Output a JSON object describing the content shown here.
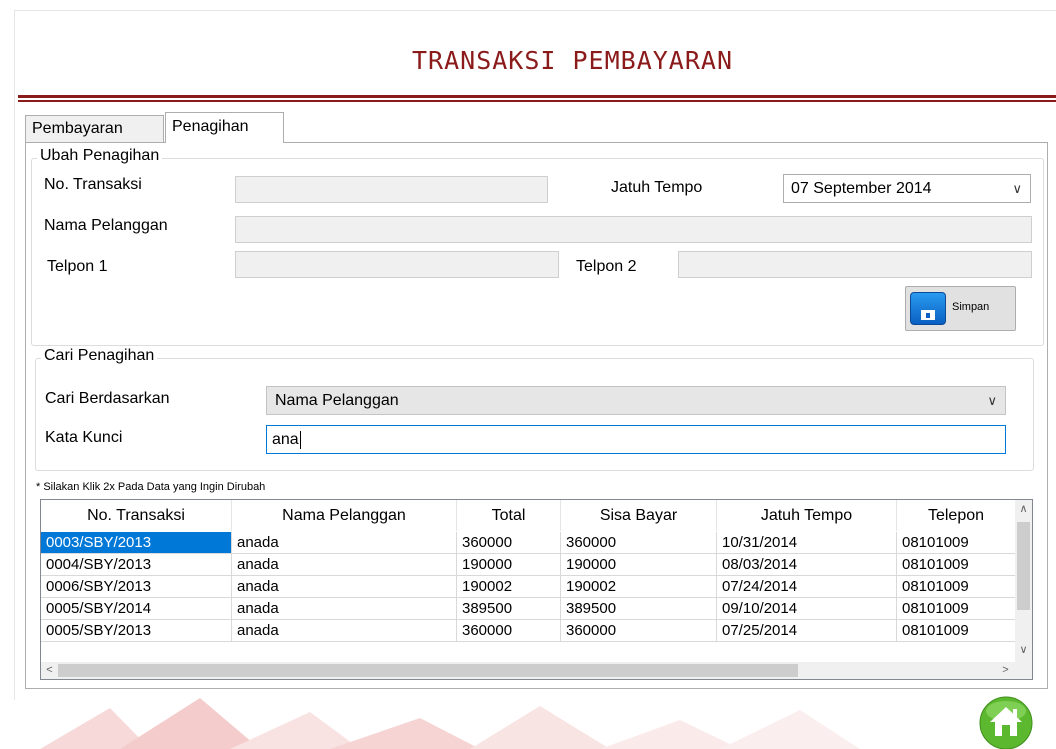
{
  "title": "TRANSAKSI PEMBAYARAN",
  "tabs": [
    {
      "label": "Pembayaran",
      "active": false
    },
    {
      "label": "Penagihan",
      "active": true
    }
  ],
  "ubah": {
    "legend": "Ubah Penagihan",
    "no_transaksi_label": "No. Transaksi",
    "no_transaksi_value": "",
    "jatuh_tempo_label": "Jatuh Tempo",
    "jatuh_tempo_value": "07 September 2014",
    "nama_pelanggan_label": "Nama Pelanggan",
    "nama_pelanggan_value": "",
    "telpon1_label": "Telpon 1",
    "telpon1_value": "",
    "telpon2_label": "Telpon 2",
    "telpon2_value": "",
    "simpan_label": "Simpan"
  },
  "cari": {
    "legend": "Cari Penagihan",
    "berdasarkan_label": "Cari Berdasarkan",
    "berdasarkan_value": "Nama Pelanggan",
    "kata_kunci_label": "Kata Kunci",
    "kata_kunci_value": "ana"
  },
  "note": "* Silakan Klik 2x Pada Data yang Ingin Dirubah",
  "table": {
    "columns": [
      "No. Transaksi",
      "Nama Pelanggan",
      "Total",
      "Sisa Bayar",
      "Jatuh Tempo",
      "Telepon"
    ],
    "rows": [
      [
        "0003/SBY/2013",
        "anada",
        "360000",
        "360000",
        "10/31/2014",
        "08101009"
      ],
      [
        "0004/SBY/2013",
        "anada",
        "190000",
        "190000",
        "08/03/2014",
        "08101009"
      ],
      [
        "0006/SBY/2013",
        "anada",
        "190002",
        "190002",
        "07/24/2014",
        "08101009"
      ],
      [
        "0005/SBY/2014",
        "anada",
        "389500",
        "389500",
        "09/10/2014",
        "08101009"
      ],
      [
        "0005/SBY/2013",
        "anada",
        "360000",
        "360000",
        "07/25/2014",
        "08101009"
      ]
    ],
    "selected_row": 0
  },
  "icons": {
    "save": "floppy-disk-icon",
    "home": "home-icon"
  },
  "colors": {
    "title": "#8b1a1a",
    "selection": "#0078d7",
    "home_green": "#5cb82e"
  }
}
